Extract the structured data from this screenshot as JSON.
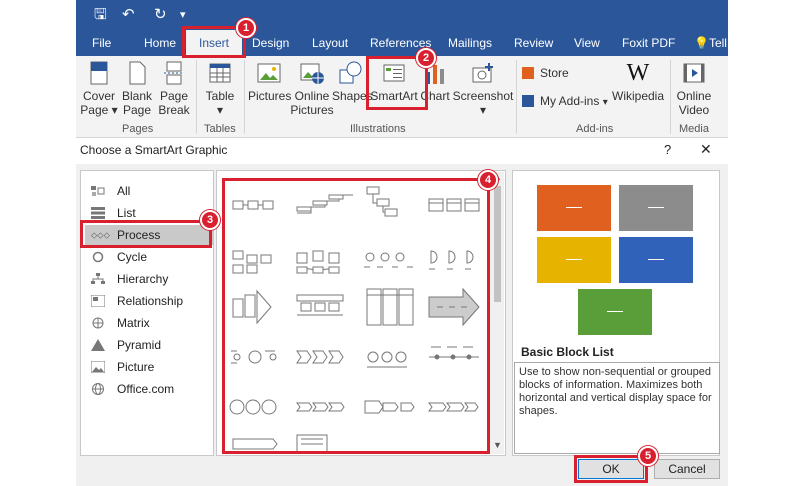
{
  "ribbon": {
    "tabs": [
      "File",
      "Home",
      "Insert",
      "Design",
      "Layout",
      "References",
      "Mailings",
      "Review",
      "View",
      "Foxit PDF",
      "Tell"
    ],
    "active_tab": "Insert",
    "buttons": {
      "cover_page": [
        "Cover",
        "Page ▾"
      ],
      "blank_page": [
        "Blank",
        "Page"
      ],
      "page_break": [
        "Page",
        "Break"
      ],
      "table": [
        "Table",
        "▾"
      ],
      "pictures": "Pictures",
      "online_pictures": [
        "Online",
        "Pictures"
      ],
      "shapes": "Shapes",
      "smartart": "SmartArt",
      "chart": "Chart",
      "screenshot": [
        "Screenshot",
        "▾"
      ],
      "store": "Store",
      "my_addins": "My Add-ins",
      "wikipedia": "Wikipedia",
      "online_video": [
        "Online",
        "Video"
      ]
    },
    "groups": [
      "Pages",
      "Tables",
      "Illustrations",
      "Add-ins",
      "Media"
    ]
  },
  "dialog": {
    "title": "Choose a SmartArt Graphic",
    "help": "?",
    "close": "✕",
    "categories": [
      "All",
      "List",
      "Process",
      "Cycle",
      "Hierarchy",
      "Relationship",
      "Matrix",
      "Pyramid",
      "Picture",
      "Office.com"
    ],
    "selected_category": "Process",
    "preview_title": "Basic Block List",
    "preview_description": "Use to show non-sequential or grouped blocks of information. Maximizes both horizontal and vertical display space for shapes.",
    "preview_colors": [
      "#e0601f",
      "#8c8c8c",
      "#e6b400",
      "#2f62b8",
      "#5a9e3a"
    ],
    "ok": "OK",
    "cancel": "Cancel"
  },
  "annotations": {
    "step_numbers": [
      "1",
      "2",
      "3",
      "4",
      "5"
    ],
    "color": "#d8202f"
  }
}
